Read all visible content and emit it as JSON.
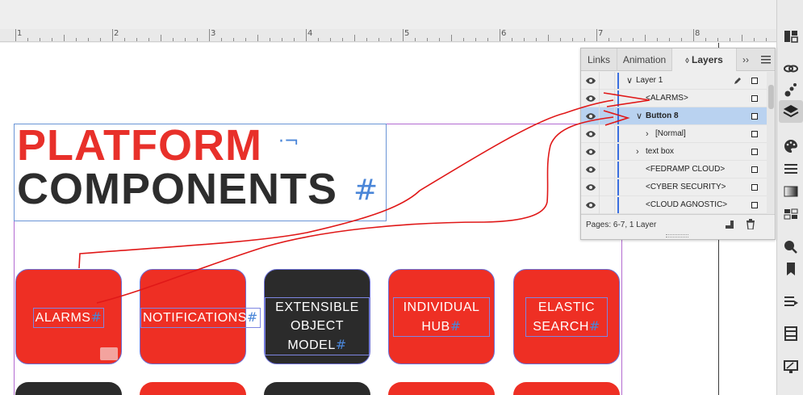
{
  "ruler": {
    "numbers": [
      "1",
      "2",
      "3",
      "4",
      "5",
      "6",
      "7",
      "8"
    ]
  },
  "document": {
    "title_line1": "PLATFORM",
    "title_line2": "COMPONENTS",
    "title_mark1": "·¬",
    "title_mark2": "#",
    "tiles": [
      {
        "line1": "ALARMS",
        "line2": "",
        "hash": "#",
        "color": "red"
      },
      {
        "line1": "NOTIFICATIONS",
        "line2": "",
        "hash": "#",
        "color": "red"
      },
      {
        "line1": "EXTENSIBLE",
        "line2": "OBJECT MODEL",
        "hash": "#",
        "color": "dark"
      },
      {
        "line1": "INDIVIDUAL",
        "line2": "HUB",
        "hash": "#",
        "color": "red"
      },
      {
        "line1": "ELASTIC",
        "line2": "SEARCH",
        "hash": "#",
        "color": "red"
      }
    ]
  },
  "panel": {
    "tabs": {
      "links": "Links",
      "animation": "Animation",
      "layers": "Layers",
      "more": "››"
    },
    "layers": [
      {
        "name": "Layer 1",
        "chevron": "∨",
        "selected": false
      },
      {
        "name": "<ALARMS>",
        "chevron": "",
        "selected": false
      },
      {
        "name": "Button 8",
        "chevron": "∨",
        "selected": true
      },
      {
        "name": "[Normal]",
        "chevron": "›",
        "selected": false
      },
      {
        "name": "text box",
        "chevron": "›",
        "selected": false
      },
      {
        "name": "<FEDRAMP CLOUD>",
        "chevron": "",
        "selected": false
      },
      {
        "name": "<CYBER SECURITY>",
        "chevron": "",
        "selected": false
      },
      {
        "name": "<CLOUD AGNOSTIC>",
        "chevron": "",
        "selected": false
      }
    ],
    "footer_text": "Pages: 6-7, 1 Layer"
  },
  "colors": {
    "brand_red": "#ee2f24",
    "dark_tile": "#2b2b2b",
    "selection": "#b9d2f0",
    "annotation": "#e01818"
  }
}
